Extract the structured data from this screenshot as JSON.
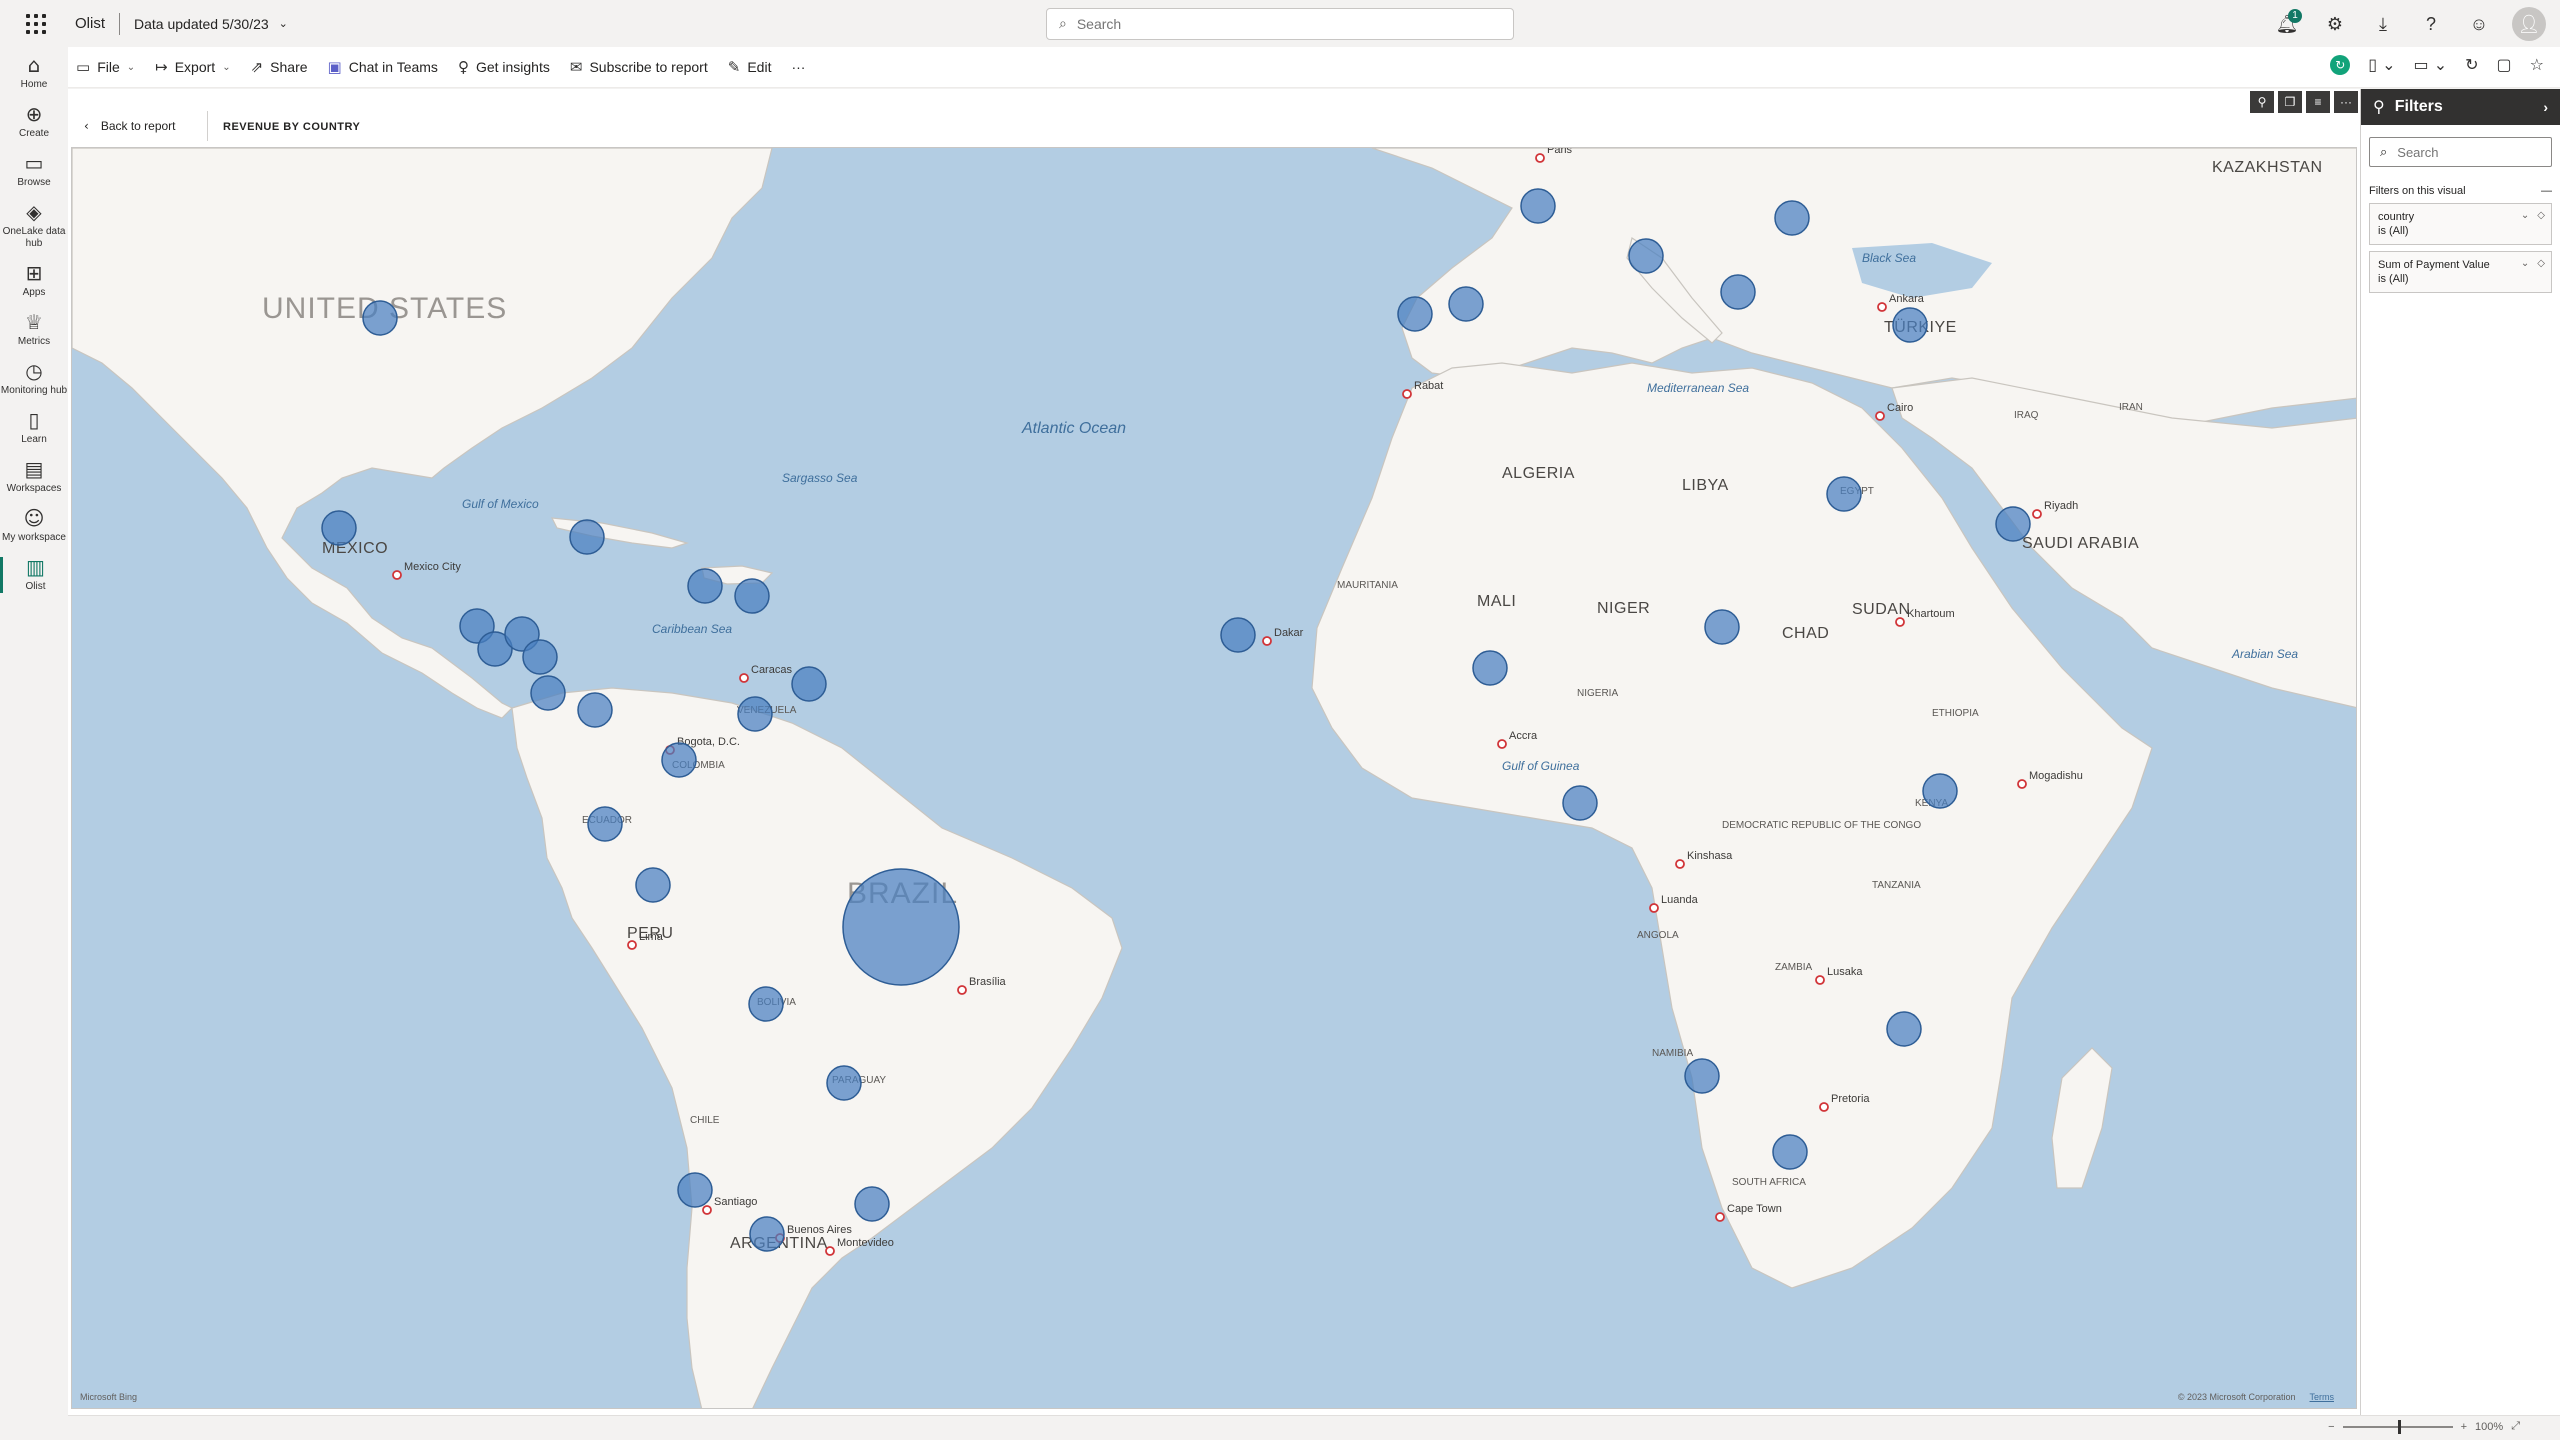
{
  "app": {
    "name": "Olist",
    "data_updated": "Data updated 5/30/23",
    "search_placeholder": "Search",
    "notification_count": "1"
  },
  "leftnav": [
    {
      "label": "Home",
      "icon": "home-icon",
      "glyph": "⌂"
    },
    {
      "label": "Create",
      "icon": "plus-circle-icon",
      "glyph": "⊕"
    },
    {
      "label": "Browse",
      "icon": "folder-icon",
      "glyph": "▭"
    },
    {
      "label": "OneLake data hub",
      "icon": "data-hub-icon",
      "glyph": "◈"
    },
    {
      "label": "Apps",
      "icon": "apps-icon",
      "glyph": "⊞"
    },
    {
      "label": "Metrics",
      "icon": "trophy-icon",
      "glyph": "♕"
    },
    {
      "label": "Monitoring hub",
      "icon": "monitor-icon",
      "glyph": "◷"
    },
    {
      "label": "Learn",
      "icon": "book-icon",
      "glyph": "▯"
    },
    {
      "label": "Workspaces",
      "icon": "workspaces-icon",
      "glyph": "▤"
    },
    {
      "label": "My workspace",
      "icon": "person-icon",
      "glyph": "☺"
    },
    {
      "label": "Olist",
      "icon": "report-icon",
      "glyph": "▥"
    }
  ],
  "actions": {
    "file": "File",
    "export": "Export",
    "share": "Share",
    "chat": "Chat in Teams",
    "insights": "Get insights",
    "subscribe": "Subscribe to report",
    "edit": "Edit",
    "more": "···"
  },
  "report": {
    "back": "Back to report",
    "visual_title": "REVENUE BY COUNTRY"
  },
  "map": {
    "attribution": "Microsoft Bing",
    "copyright": "© 2023 Microsoft Corporation",
    "terms": "Terms",
    "labels": {
      "usa": "UNITED STATES",
      "mexico": "MEXICO",
      "brazil": "BRAZIL",
      "peru": "PERU",
      "bolivia": "BOLIVIA",
      "colombia": "COLOMBIA",
      "venezuela": "VENEZUELA",
      "ecuador": "ECUADOR",
      "chile": "CHILE",
      "argentina": "ARGENTINA",
      "paraguay": "PARAGUAY",
      "algeria": "ALGERIA",
      "libya": "LIBYA",
      "mali": "MALI",
      "niger": "NIGER",
      "mauritania": "MAURITANIA",
      "nigeria": "NIGERIA",
      "chad": "CHAD",
      "sudan": "SUDAN",
      "egypt": "EGYPT",
      "saudi": "SAUDI ARABIA",
      "ethiopia": "ETHIOPIA",
      "drc": "DEMOCRATIC REPUBLIC OF THE CONGO",
      "angola": "ANGOLA",
      "namibia": "NAMIBIA",
      "south_africa": "SOUTH AFRICA",
      "tanzania": "TANZANIA",
      "kenya": "KENYA",
      "zambia": "ZAMBIA",
      "turkey": "TÜRKIYE",
      "iran": "IRAN",
      "iraq": "IRAQ",
      "kazakhstan": "KAZAKHSTAN",
      "atlantic": "Atlantic Ocean",
      "caribbean": "Caribbean Sea",
      "gulf_mexico": "Gulf of Mexico",
      "mediterranean": "Mediterranean Sea",
      "arabian": "Arabian Sea",
      "sargasso": "Sargasso Sea",
      "black_sea": "Black Sea",
      "gulf_guinea": "Gulf of Guinea"
    },
    "cities": {
      "paris": "Paris",
      "mexico_city": "Mexico City",
      "caracas": "Caracas",
      "bogota": "Bogota, D.C.",
      "lima": "Lima",
      "brasilia": "Brasília",
      "santiago": "Santiago",
      "buenos_aires": "Buenos Aires",
      "montevideo": "Montevideo",
      "dakar": "Dakar",
      "accra": "Accra",
      "luanda": "Luanda",
      "cape_town": "Cape Town",
      "cairo": "Cairo",
      "riyadh": "Riyadh",
      "ankara": "Ankara",
      "rabat": "Rabat",
      "nairobi": "Mogadishu",
      "khartoum": "Khartoum",
      "kinshasa": "Kinshasa",
      "lusaka": "Lusaka",
      "pretoria": "Pretoria"
    },
    "bubbles": [
      {
        "name": "Brazil",
        "value": 100
      },
      {
        "name": "United States",
        "value": 10
      },
      {
        "name": "Mexico",
        "value": 10
      },
      {
        "name": "France",
        "value": 10
      },
      {
        "name": "Spain",
        "value": 10
      },
      {
        "name": "Portugal",
        "value": 10
      },
      {
        "name": "Italy",
        "value": 10
      },
      {
        "name": "Romania",
        "value": 10
      },
      {
        "name": "Greece",
        "value": 10
      },
      {
        "name": "Türkiye",
        "value": 10
      },
      {
        "name": "Egypt",
        "value": 10
      },
      {
        "name": "Saudi Arabia",
        "value": 10
      },
      {
        "name": "Chad",
        "value": 10
      },
      {
        "name": "Kenya",
        "value": 10
      },
      {
        "name": "Mozambique",
        "value": 10
      },
      {
        "name": "Namibia",
        "value": 10
      },
      {
        "name": "Lesotho",
        "value": 10
      },
      {
        "name": "Gabon",
        "value": 10
      },
      {
        "name": "Ghana",
        "value": 10
      },
      {
        "name": "Cape Verde",
        "value": 10
      },
      {
        "name": "Cuba",
        "value": 10
      },
      {
        "name": "Dominican Republic",
        "value": 10
      },
      {
        "name": "Puerto Rico",
        "value": 10
      },
      {
        "name": "Guatemala",
        "value": 10
      },
      {
        "name": "El Salvador",
        "value": 10
      },
      {
        "name": "Honduras",
        "value": 10
      },
      {
        "name": "Nicaragua",
        "value": 10
      },
      {
        "name": "Costa Rica",
        "value": 10
      },
      {
        "name": "Panama",
        "value": 10
      },
      {
        "name": "Venezuela",
        "value": 10
      },
      {
        "name": "Trinidad and Tobago",
        "value": 10
      },
      {
        "name": "Colombia",
        "value": 10
      },
      {
        "name": "Ecuador",
        "value": 10
      },
      {
        "name": "Peru",
        "value": 10
      },
      {
        "name": "Bolivia",
        "value": 10
      },
      {
        "name": "Paraguay",
        "value": 10
      },
      {
        "name": "Chile",
        "value": 10
      },
      {
        "name": "Argentina",
        "value": 10
      },
      {
        "name": "Uruguay",
        "value": 10
      }
    ]
  },
  "filters": {
    "title": "Filters",
    "search_placeholder": "Search",
    "section": "Filters on this visual",
    "cards": [
      {
        "name": "country",
        "value": "is (All)"
      },
      {
        "name": "Sum of Payment Value",
        "value": "is (All)"
      }
    ]
  },
  "status": {
    "zoom": "100%"
  }
}
